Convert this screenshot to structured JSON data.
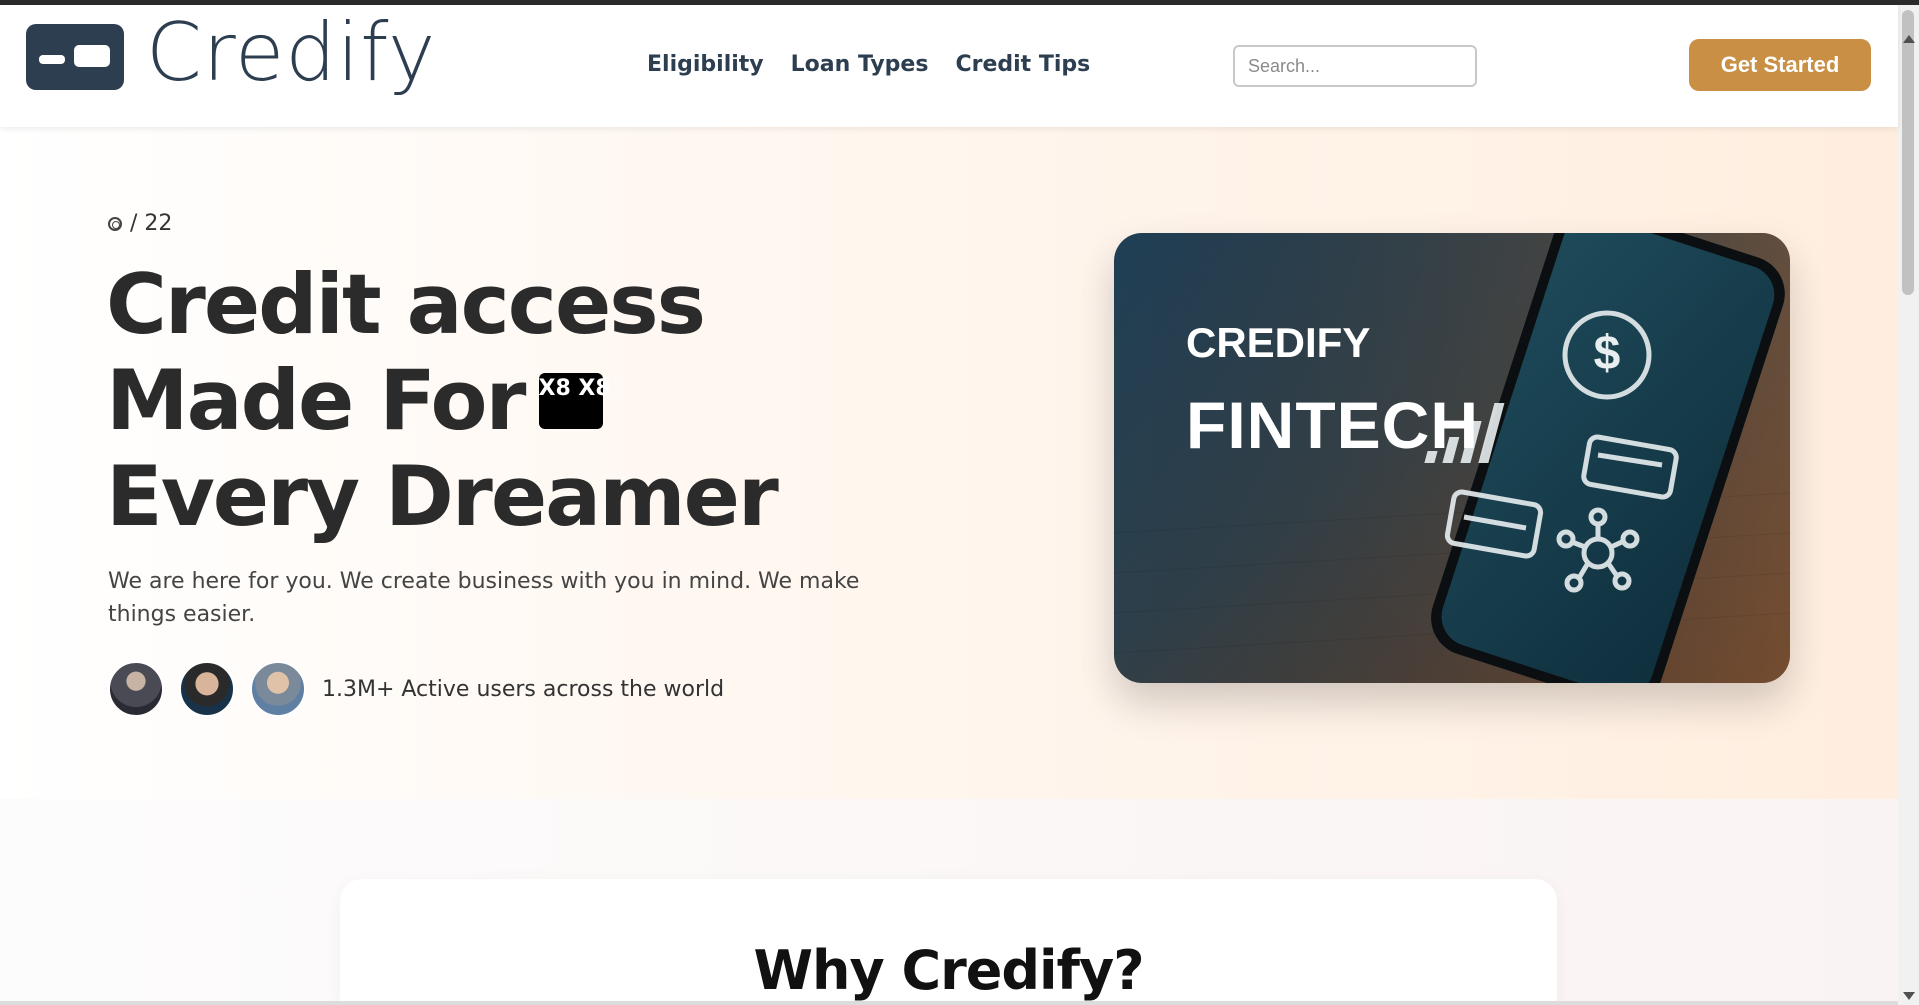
{
  "brand": {
    "name": "Credify",
    "logo_icon": "id-card-icon",
    "color": "#2c3e50"
  },
  "nav": {
    "items": [
      "Eligibility",
      "Loan Types",
      "Credit Tips"
    ]
  },
  "search": {
    "placeholder": "Search...",
    "value": ""
  },
  "header": {
    "cta_label": "Get Started",
    "cta_color": "#c88f45"
  },
  "hero": {
    "counter": "/ 22",
    "headline": {
      "line1": "Credit access",
      "line2": "Made For",
      "line3": "Every Dreamer"
    },
    "badge_glyph": "X8 X8",
    "subtext": "We are here for you. We create business with you in mind. We make things easier.",
    "users_text": "1.3M+ Active users across the world",
    "avatars": [
      "avatar-1",
      "avatar-2",
      "avatar-3"
    ],
    "card": {
      "brand": "CREDIFY",
      "title": "FINTECH",
      "icons": [
        "dollar-icon",
        "signal-bars-icon",
        "card-icon",
        "network-icon"
      ]
    }
  },
  "why": {
    "title": "Why Credify?"
  }
}
